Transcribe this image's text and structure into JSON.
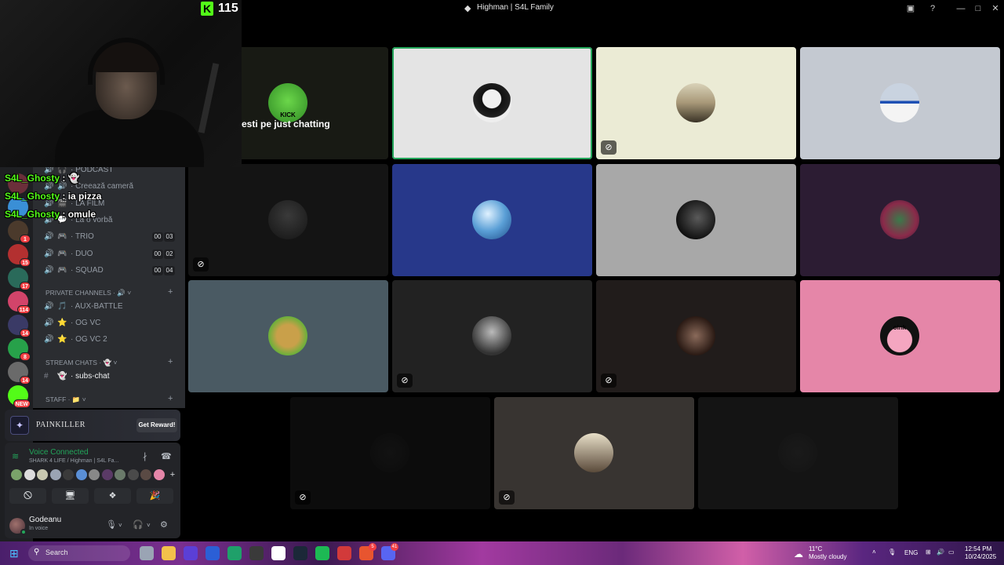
{
  "window": {
    "title": "Highman | S4L Family",
    "minimize_glyph": "—",
    "maximize_glyph": "□",
    "close_glyph": "✕"
  },
  "stream_overlay": {
    "viewer_count": "115",
    "kick_letter": "K",
    "caption": "esti pe just chatting",
    "chat": [
      {
        "user": "S4L_Ghosty",
        "sep": " : ",
        "msg": "👻"
      },
      {
        "user": "S4L_Ghosty",
        "sep": " : ",
        "msg": "ia pizza"
      },
      {
        "user": "S4L_Ghosty",
        "sep": " : ",
        "msg": "omule"
      }
    ]
  },
  "tiles": [
    {
      "bg": "#181a14",
      "avatar": "kick-avatar",
      "av_label": "KICK",
      "muted": false
    },
    {
      "bg": "#e4e4e4",
      "avatar": "woman-portrait-avatar",
      "muted": false,
      "speaking": true
    },
    {
      "bg": "#ebebd5",
      "avatar": "sunset-avatar",
      "muted": true
    },
    {
      "bg": "#c4c9d1",
      "avatar": "flag-avatar",
      "muted": false
    },
    {
      "bg": "#141414",
      "avatar": "dark-man-avatar",
      "muted": true
    },
    {
      "bg": "#27388a",
      "avatar": "blue-sphere-avatar",
      "muted": false
    },
    {
      "bg": "#a8a8a8",
      "avatar": "sunglasses-man-avatar",
      "muted": false
    },
    {
      "bg": "#2c1c33",
      "avatar": "colorful-char-avatar",
      "muted": false
    },
    {
      "bg": "#4a5a63",
      "avatar": "cartoon-bear-avatar",
      "muted": false
    },
    {
      "bg": "#222222",
      "avatar": "couple-avatar",
      "muted": true
    },
    {
      "bg": "#211c1b",
      "avatar": "group-photo-avatar",
      "muted": true
    },
    {
      "bg": "#e586a8",
      "avatar": "oink-pig-avatar",
      "av_label": "oink",
      "muted": false
    },
    {
      "bg": "#0c0c0c",
      "avatar": "hidden-avatar",
      "muted": true
    },
    {
      "bg": "#383431",
      "avatar": "selfie-avatar",
      "muted": true
    },
    {
      "bg": "#141414",
      "avatar": "hidden-avatar-2",
      "muted": false
    }
  ],
  "sidebar": {
    "channels": [
      {
        "name": "PODCAST",
        "emoji": "🎧"
      },
      {
        "name": "Creează cameră",
        "emoji": "🔊"
      },
      {
        "name": "LA FILM",
        "emoji": "🎬"
      },
      {
        "name": "La o vorbă",
        "emoji": "💬"
      },
      {
        "name": "TRIO",
        "emoji": "🎮",
        "a": "00",
        "b": "03"
      },
      {
        "name": "DUO",
        "emoji": "🎮",
        "a": "00",
        "b": "02"
      },
      {
        "name": "SQUAD",
        "emoji": "🎮",
        "a": "00",
        "b": "04"
      }
    ],
    "cat_private": "PRIVATE CHANNELS · 🔊",
    "private": [
      {
        "name": "AUX-BATTLE",
        "emoji": "🎵"
      },
      {
        "name": "OG VC",
        "emoji": "⭐"
      },
      {
        "name": "OG VC 2",
        "emoji": "⭐"
      }
    ],
    "cat_stream": "STREAM CHATS · 👻",
    "subs_chat": "subs-chat",
    "cat_staff": "STAFF · 📁",
    "dot": "·",
    "plus": "+",
    "chevron": "˅",
    "servers": [
      {
        "badge": "",
        "color": "#6b2f3a"
      },
      {
        "badge": "",
        "color": "#3a8fd6"
      },
      {
        "badge": "1",
        "color": "#4b3a2c"
      },
      {
        "badge": "15",
        "color": "#b33030"
      },
      {
        "badge": "17",
        "color": "#2a6a5a"
      },
      {
        "badge": "114",
        "color": "#d2446a"
      },
      {
        "badge": "14",
        "color": "#3a3a66"
      },
      {
        "badge": "8",
        "color": "#27a14a"
      },
      {
        "badge": "14",
        "color": "#6a6a6a"
      },
      {
        "badge": "NEW",
        "color": "#53fc18"
      }
    ]
  },
  "promo": {
    "name": "PAINKILLER",
    "button": "Get Reward!",
    "logo": "✦"
  },
  "voice": {
    "status": "Voice Connected",
    "location": "SHARK 4 LIFE / Highman | S4L Fa...",
    "participant_colors": [
      "#7aa36a",
      "#dcdcdc",
      "#c8c8b0",
      "#9aa4b4",
      "#3a3a3a",
      "#5a8fd6",
      "#888888",
      "#5a3a66",
      "#6a7a6a",
      "#4a4a4a",
      "#5a4a44",
      "#e586a8"
    ],
    "add": "+"
  },
  "user": {
    "name": "Godeanu",
    "status": "In voice"
  },
  "taskbar": {
    "search": "Search",
    "weather_temp": "11°C",
    "weather_desc": "Mostly cloudy",
    "lang": "ENG",
    "time": "12:54 PM",
    "date": "10/24/2025",
    "apps": [
      {
        "color": "#9aa4b4",
        "badge": ""
      },
      {
        "color": "#f3c14b",
        "badge": ""
      },
      {
        "color": "#5b3fd6",
        "badge": ""
      },
      {
        "color": "#2b5fd6",
        "badge": ""
      },
      {
        "color": "#1fa06a",
        "badge": ""
      },
      {
        "color": "#3a3a3a",
        "badge": ""
      },
      {
        "color": "#ffffff",
        "badge": ""
      },
      {
        "color": "#1b2838",
        "badge": ""
      },
      {
        "color": "#1db954",
        "badge": ""
      },
      {
        "color": "#d23a3a",
        "badge": ""
      },
      {
        "color": "#e8552f",
        "badge": "5"
      },
      {
        "color": "#5865f2",
        "badge": "41"
      }
    ]
  }
}
